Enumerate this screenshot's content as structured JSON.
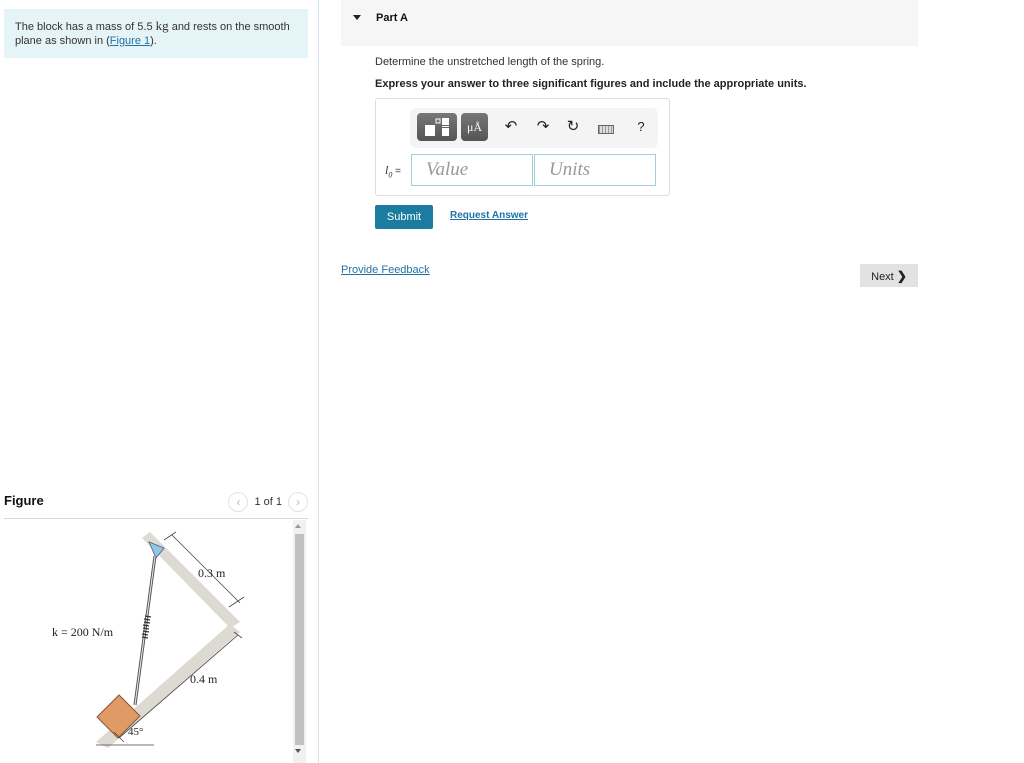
{
  "problem": {
    "text_before": "The block has a mass of 5.5 ",
    "unit": "kg",
    "text_after": " and rests on the smooth plane as shown in (",
    "figure_link": "Figure 1",
    "text_end": ")."
  },
  "figure_panel": {
    "title": "Figure",
    "counter": "1 of 1",
    "prev_icon": "chevron-left-icon",
    "next_icon": "chevron-right-icon",
    "diagram": {
      "spring_label": "k = 200 N/m",
      "dim_upper": "0.3 m",
      "dim_lower": "0.4 m",
      "angle": "45°"
    }
  },
  "part": {
    "title": "Part A",
    "question": "Determine the unstretched length of the spring.",
    "instruction": "Express your answer to three significant figures and include the appropriate units."
  },
  "toolbar": {
    "templates_icon": "templates-icon",
    "units_label": "μÅ",
    "undo_icon": "undo-icon",
    "redo_icon": "redo-icon",
    "reset_icon": "reset-icon",
    "keyboard_icon": "keyboard-icon",
    "help_label": "?"
  },
  "answer": {
    "variable": "l",
    "subscript": "0",
    "equals": " =",
    "value_placeholder": "Value",
    "value": "",
    "units_placeholder": "Units",
    "units": ""
  },
  "actions": {
    "submit_label": "Submit",
    "request_answer_label": "Request Answer",
    "feedback_label": "Provide Feedback",
    "next_label": "Next"
  },
  "colors": {
    "accent": "#1b7ca0",
    "link": "#1f73a6",
    "problem_bg": "#e5f4f7",
    "block": "#e09a65"
  }
}
